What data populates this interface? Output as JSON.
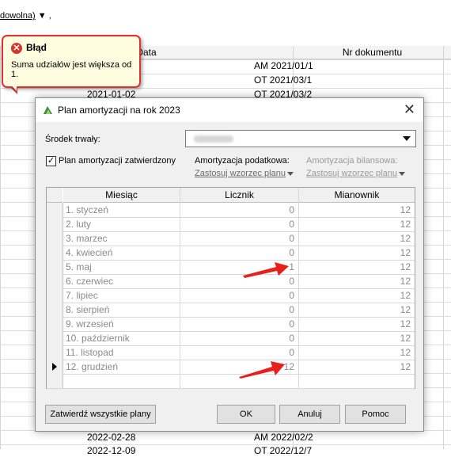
{
  "background": {
    "top_link": "dowolna)",
    "top_trailing": ",",
    "headers": {
      "date": "Data",
      "doc": "Nr dokumentu"
    },
    "rows_top": [
      {
        "date": "",
        "doc": "AM 2021/01/1"
      },
      {
        "date": "",
        "doc": "OT 2021/03/1"
      },
      {
        "date": "2021-01-02",
        "doc": "OT 2021/03/2"
      }
    ],
    "rows_bottom": [
      {
        "date": "2022-02-28",
        "doc": "AM 2022/02/2"
      },
      {
        "date": "2022-12-09",
        "doc": "OT 2022/12/7"
      }
    ]
  },
  "error_balloon": {
    "title": "Błąd",
    "message": "Suma udziałów jest większa od 1.",
    "icon": "error-x-icon",
    "border_color": "#e03131"
  },
  "dialog": {
    "title": "Plan amortyzacji na rok 2023",
    "app_icon": "st-logo-icon",
    "close": "✕",
    "asset_label": "Środek trwały:",
    "checkbox_label": "Plan amortyzacji zatwierdzony",
    "checkbox_checked": true,
    "tax_label": "Amortyzacja podatkowa:",
    "tax_link": "Zastosuj wzorzec planu",
    "balance_label": "Amortyzacja bilansowa:",
    "balance_link": "Zastosuj wzorzec planu",
    "grid": {
      "columns": [
        "Miesiąc",
        "Licznik",
        "Mianownik"
      ],
      "rows": [
        {
          "month": "1. styczeń",
          "num": "0",
          "den": "12"
        },
        {
          "month": "2. luty",
          "num": "0",
          "den": "12"
        },
        {
          "month": "3. marzec",
          "num": "0",
          "den": "12"
        },
        {
          "month": "4. kwiecień",
          "num": "0",
          "den": "12"
        },
        {
          "month": "5. maj",
          "num": "1",
          "den": "12"
        },
        {
          "month": "6. czerwiec",
          "num": "0",
          "den": "12"
        },
        {
          "month": "7. lipiec",
          "num": "0",
          "den": "12"
        },
        {
          "month": "8. sierpień",
          "num": "0",
          "den": "12"
        },
        {
          "month": "9. wrzesień",
          "num": "0",
          "den": "12"
        },
        {
          "month": "10. październik",
          "num": "0",
          "den": "12"
        },
        {
          "month": "11. listopad",
          "num": "0",
          "den": "12"
        },
        {
          "month": "12. grudzień",
          "num": "12",
          "den": "12"
        }
      ],
      "current_row_index": 11
    },
    "buttons": {
      "approve_all": "Zatwierdź wszystkie plany",
      "ok": "OK",
      "cancel": "Anuluj",
      "help": "Pomoc"
    }
  },
  "annotation_color": "#e8201c"
}
